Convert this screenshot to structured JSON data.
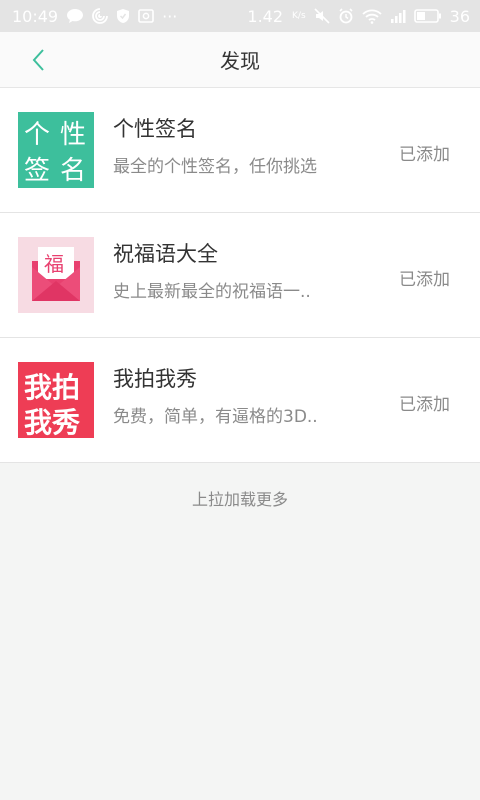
{
  "status_bar": {
    "time": "10:49",
    "net_speed": "1.42",
    "net_speed_unit": "K/s",
    "battery": "36",
    "more": "···",
    "icons": [
      "message-icon",
      "swirl-icon",
      "shield-icon",
      "gallery-icon",
      "mute-icon",
      "alarm-icon",
      "wifi-icon",
      "signal-icon",
      "battery-icon"
    ]
  },
  "header": {
    "title": "发现",
    "back_icon": "chevron-left-icon",
    "accent": "#3dbf9c"
  },
  "items": [
    {
      "title": "个性签名",
      "description": "最全的个性签名，任你挑选",
      "status": "已添加",
      "thumb_text": [
        "个",
        "性",
        "签",
        "名"
      ],
      "thumb_color": "#3dbf9c"
    },
    {
      "title": "祝福语大全",
      "description": "史上最新最全的祝福语一..",
      "status": "已添加",
      "thumb_text": [
        "福"
      ],
      "thumb_color": "#f7dbe3"
    },
    {
      "title": "我拍我秀",
      "description": "免费，简单，有逼格的3D..",
      "status": "已添加",
      "thumb_text": [
        "我拍",
        "我秀"
      ],
      "thumb_color": "#ee3d55"
    }
  ],
  "footer": {
    "load_more": "上拉加载更多"
  }
}
